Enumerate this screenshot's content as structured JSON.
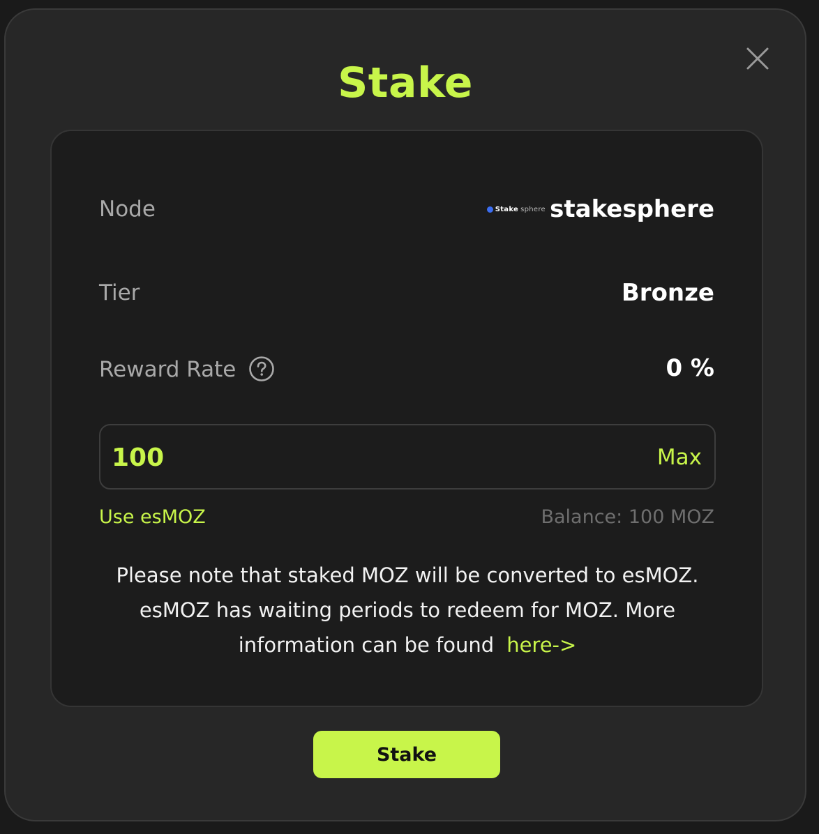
{
  "modal": {
    "title": "Stake",
    "close_icon": "close-icon"
  },
  "node": {
    "label": "Node",
    "logo_text_bold": "Stake",
    "logo_text_light": "sphere",
    "value": "stakesphere"
  },
  "tier": {
    "label": "Tier",
    "value": "Bronze"
  },
  "reward_rate": {
    "label": "Reward Rate",
    "help_icon": "question-circle-icon",
    "value": "0 %"
  },
  "amount": {
    "value": "100",
    "max_label": "Max"
  },
  "use_esmoz_label": "Use esMOZ",
  "balance_text": "Balance: 100 MOZ",
  "note": {
    "text": "Please note that staked MOZ will be converted to esMOZ. esMOZ has waiting periods to redeem for MOZ. More information can be found",
    "link_text": "here->"
  },
  "stake_button_label": "Stake",
  "colors": {
    "accent": "#c8f54a",
    "modal_bg": "#272727",
    "card_bg": "#1c1c1c"
  }
}
